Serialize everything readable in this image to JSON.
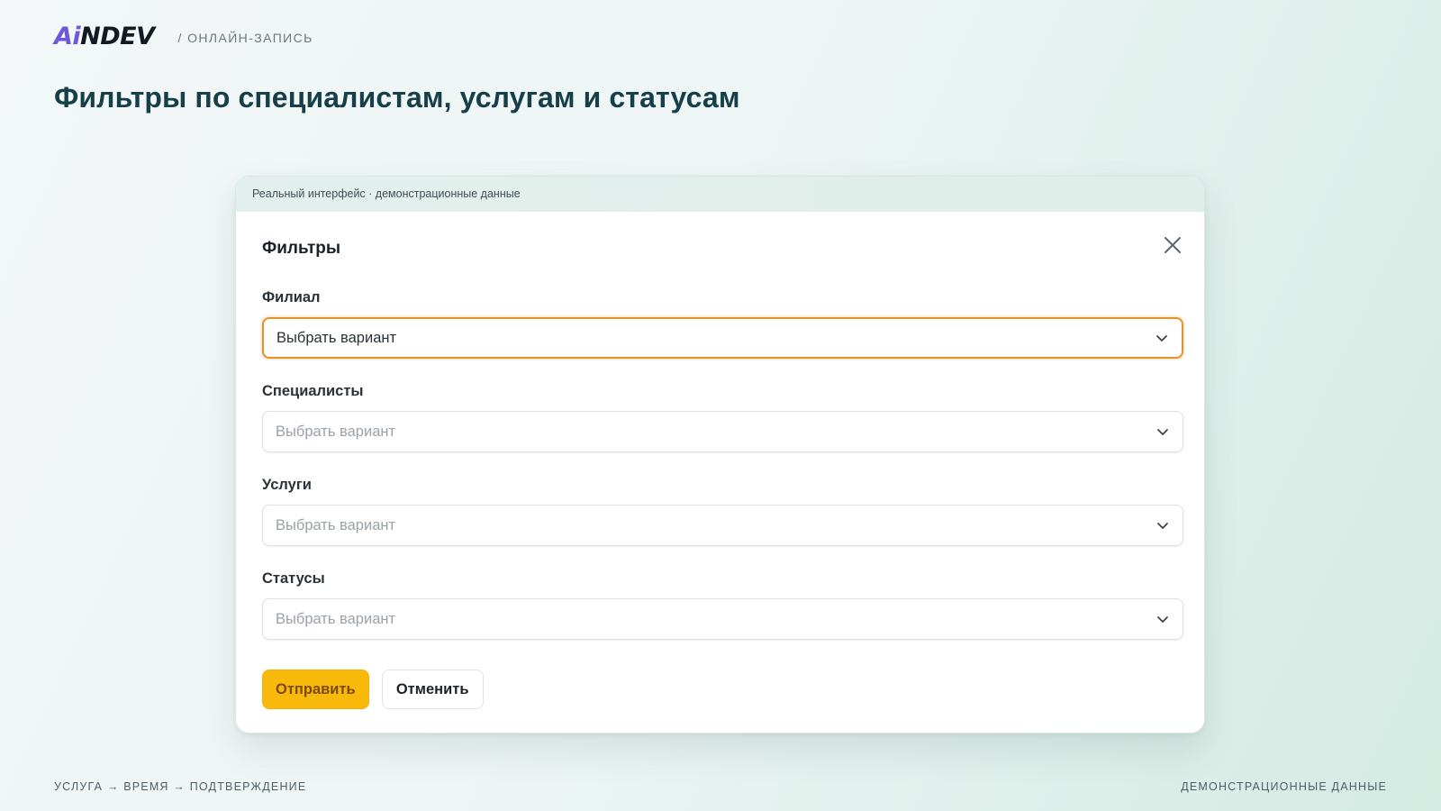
{
  "header": {
    "logo_ai": "Ai",
    "logo_rest": "NDEV",
    "crumb": "/ ОНЛАЙН-ЗАПИСЬ"
  },
  "page_title": "Фильтры по специалистам, услугам и статусам",
  "frame": {
    "bar_text": "Реальный интерфейс · демонстрационные данные"
  },
  "modal": {
    "title": "Фильтры",
    "fields": [
      {
        "label": "Филиал",
        "value": "Выбрать вариант",
        "placeholder": "Выбрать вариант"
      },
      {
        "label": "Специалисты",
        "value": "Выбрать вариант",
        "placeholder": "Выбрать вариант"
      },
      {
        "label": "Услуги",
        "value": "Выбрать вариант",
        "placeholder": "Выбрать вариант"
      },
      {
        "label": "Статусы",
        "value": "Выбрать вариант",
        "placeholder": "Выбрать вариант"
      }
    ],
    "submit_label": "Отправить",
    "cancel_label": "Отменить"
  },
  "footer": {
    "left": "УСЛУГА → ВРЕМЯ → ПОДТВЕРЖДЕНИЕ",
    "right": "ДЕМОНСТРАЦИОННЫЕ ДАННЫЕ"
  },
  "colors": {
    "accent": "#f9b90a",
    "focus_border": "#e3932b",
    "title": "#163f4a",
    "logo_ai": "#6e57d8"
  },
  "icons": {
    "close": "close-icon",
    "chevron": "chevron-down-icon"
  }
}
